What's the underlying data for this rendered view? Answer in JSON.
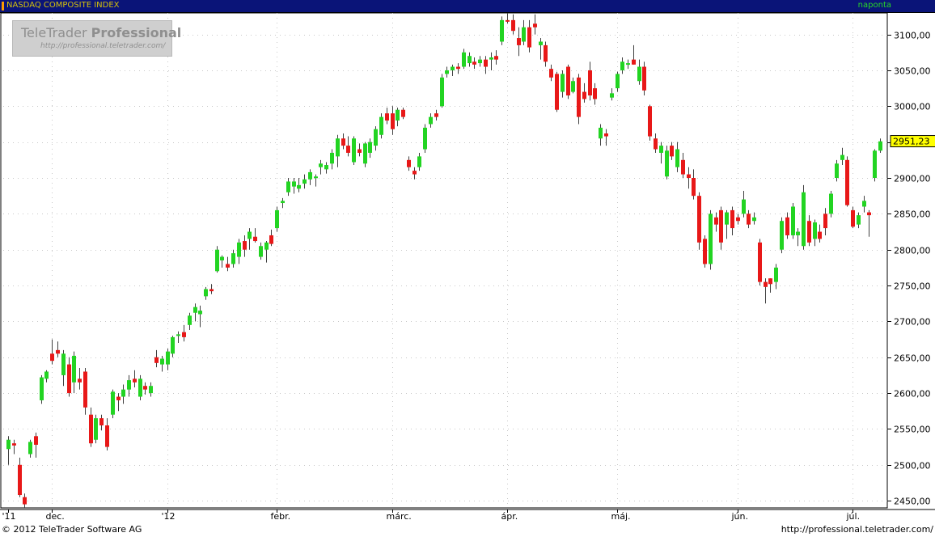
{
  "header": {
    "title": "NASDAQ COMPOSITE INDEX",
    "period": "naponta"
  },
  "watermark": {
    "brand_light": "TeleTrader ",
    "brand_bold": "Professional",
    "site": "http://professional.teletrader.com/"
  },
  "footer": {
    "copyright": "© 2012 TeleTrader Software AG",
    "url": "http://professional.teletrader.com/"
  },
  "colors": {
    "up": "#22d422",
    "down": "#e81818",
    "wick": "#404040",
    "grid": "#c8c8c8",
    "axis_text": "#000000",
    "last_price_bg": "#ffff00"
  },
  "chart_data": {
    "type": "candlestick",
    "y_axis": {
      "min": 2440,
      "max": 3130,
      "ticks": [
        2450,
        2500,
        2550,
        2600,
        2650,
        2700,
        2750,
        2800,
        2850,
        2900,
        2950,
        3000,
        3050,
        3100
      ],
      "tick_labels": [
        "2450,00",
        "2500,00",
        "2550,00",
        "2600,00",
        "2650,00",
        "2700,00",
        "2750,00",
        "2800,00",
        "2850,00",
        "2900,00",
        "2950,00",
        "3000,00",
        "3050,00",
        "3100,00"
      ]
    },
    "last_price": {
      "value": 2951.23,
      "label": "2951,23"
    },
    "x_axis": {
      "labels": [
        {
          "text": "'11",
          "index": 0
        },
        {
          "text": "dec.",
          "index": 8
        },
        {
          "text": "'12",
          "index": 29
        },
        {
          "text": "febr.",
          "index": 49
        },
        {
          "text": "márc.",
          "index": 70
        },
        {
          "text": "ápr.",
          "index": 91
        },
        {
          "text": "máj.",
          "index": 111
        },
        {
          "text": "jún.",
          "index": 133
        },
        {
          "text": "júl.",
          "index": 154
        }
      ]
    },
    "grid": true,
    "candles": [
      {
        "o": 2522,
        "h": 2540,
        "l": 2500,
        "c": 2535
      },
      {
        "o": 2530,
        "h": 2535,
        "l": 2515,
        "c": 2527
      },
      {
        "o": 2500,
        "h": 2510,
        "l": 2455,
        "c": 2458
      },
      {
        "o": 2455,
        "h": 2460,
        "l": 2440,
        "c": 2445
      },
      {
        "o": 2515,
        "h": 2535,
        "l": 2510,
        "c": 2532
      },
      {
        "o": 2540,
        "h": 2545,
        "l": 2510,
        "c": 2528
      },
      {
        "o": 2590,
        "h": 2625,
        "l": 2585,
        "c": 2622
      },
      {
        "o": 2620,
        "h": 2632,
        "l": 2615,
        "c": 2630
      },
      {
        "o": 2655,
        "h": 2675,
        "l": 2640,
        "c": 2645
      },
      {
        "o": 2660,
        "h": 2672,
        "l": 2650,
        "c": 2655
      },
      {
        "o": 2625,
        "h": 2660,
        "l": 2610,
        "c": 2655
      },
      {
        "o": 2640,
        "h": 2650,
        "l": 2595,
        "c": 2600
      },
      {
        "o": 2615,
        "h": 2658,
        "l": 2600,
        "c": 2652
      },
      {
        "o": 2620,
        "h": 2635,
        "l": 2605,
        "c": 2615
      },
      {
        "o": 2630,
        "h": 2635,
        "l": 2570,
        "c": 2580
      },
      {
        "o": 2570,
        "h": 2580,
        "l": 2525,
        "c": 2530
      },
      {
        "o": 2535,
        "h": 2570,
        "l": 2530,
        "c": 2565
      },
      {
        "o": 2565,
        "h": 2570,
        "l": 2548,
        "c": 2555
      },
      {
        "o": 2555,
        "h": 2565,
        "l": 2520,
        "c": 2525
      },
      {
        "o": 2570,
        "h": 2605,
        "l": 2565,
        "c": 2602
      },
      {
        "o": 2595,
        "h": 2600,
        "l": 2575,
        "c": 2590
      },
      {
        "o": 2595,
        "h": 2612,
        "l": 2585,
        "c": 2605
      },
      {
        "o": 2605,
        "h": 2625,
        "l": 2595,
        "c": 2618
      },
      {
        "o": 2620,
        "h": 2632,
        "l": 2608,
        "c": 2615
      },
      {
        "o": 2595,
        "h": 2625,
        "l": 2590,
        "c": 2620
      },
      {
        "o": 2610,
        "h": 2615,
        "l": 2598,
        "c": 2605
      },
      {
        "o": 2600,
        "h": 2615,
        "l": 2595,
        "c": 2610
      },
      {
        "o": 2650,
        "h": 2660,
        "l": 2636,
        "c": 2642
      },
      {
        "o": 2640,
        "h": 2652,
        "l": 2630,
        "c": 2648
      },
      {
        "o": 2640,
        "h": 2662,
        "l": 2632,
        "c": 2658
      },
      {
        "o": 2655,
        "h": 2680,
        "l": 2650,
        "c": 2678
      },
      {
        "o": 2680,
        "h": 2686,
        "l": 2670,
        "c": 2682
      },
      {
        "o": 2685,
        "h": 2695,
        "l": 2672,
        "c": 2678
      },
      {
        "o": 2695,
        "h": 2712,
        "l": 2688,
        "c": 2708
      },
      {
        "o": 2712,
        "h": 2725,
        "l": 2700,
        "c": 2720
      },
      {
        "o": 2710,
        "h": 2722,
        "l": 2692,
        "c": 2715
      },
      {
        "o": 2735,
        "h": 2748,
        "l": 2730,
        "c": 2745
      },
      {
        "o": 2745,
        "h": 2752,
        "l": 2738,
        "c": 2742
      },
      {
        "o": 2770,
        "h": 2805,
        "l": 2768,
        "c": 2800
      },
      {
        "o": 2785,
        "h": 2792,
        "l": 2775,
        "c": 2790
      },
      {
        "o": 2780,
        "h": 2790,
        "l": 2770,
        "c": 2775
      },
      {
        "o": 2780,
        "h": 2800,
        "l": 2775,
        "c": 2795
      },
      {
        "o": 2790,
        "h": 2815,
        "l": 2780,
        "c": 2810
      },
      {
        "o": 2812,
        "h": 2820,
        "l": 2790,
        "c": 2800
      },
      {
        "o": 2815,
        "h": 2830,
        "l": 2800,
        "c": 2825
      },
      {
        "o": 2818,
        "h": 2830,
        "l": 2810,
        "c": 2812
      },
      {
        "o": 2790,
        "h": 2810,
        "l": 2786,
        "c": 2805
      },
      {
        "o": 2800,
        "h": 2812,
        "l": 2782,
        "c": 2810
      },
      {
        "o": 2820,
        "h": 2828,
        "l": 2805,
        "c": 2808
      },
      {
        "o": 2830,
        "h": 2860,
        "l": 2825,
        "c": 2855
      },
      {
        "o": 2865,
        "h": 2872,
        "l": 2858,
        "c": 2868
      },
      {
        "o": 2880,
        "h": 2900,
        "l": 2875,
        "c": 2895
      },
      {
        "o": 2888,
        "h": 2900,
        "l": 2878,
        "c": 2895
      },
      {
        "o": 2885,
        "h": 2900,
        "l": 2880,
        "c": 2890
      },
      {
        "o": 2892,
        "h": 2905,
        "l": 2885,
        "c": 2898
      },
      {
        "o": 2898,
        "h": 2912,
        "l": 2890,
        "c": 2908
      },
      {
        "o": 2900,
        "h": 2905,
        "l": 2888,
        "c": 2902
      },
      {
        "o": 2915,
        "h": 2925,
        "l": 2905,
        "c": 2920
      },
      {
        "o": 2912,
        "h": 2922,
        "l": 2906,
        "c": 2918
      },
      {
        "o": 2920,
        "h": 2940,
        "l": 2912,
        "c": 2935
      },
      {
        "o": 2930,
        "h": 2960,
        "l": 2915,
        "c": 2955
      },
      {
        "o": 2955,
        "h": 2962,
        "l": 2940,
        "c": 2945
      },
      {
        "o": 2945,
        "h": 2958,
        "l": 2930,
        "c": 2935
      },
      {
        "o": 2922,
        "h": 2958,
        "l": 2918,
        "c": 2955
      },
      {
        "o": 2940,
        "h": 2948,
        "l": 2930,
        "c": 2935
      },
      {
        "o": 2920,
        "h": 2950,
        "l": 2915,
        "c": 2948
      },
      {
        "o": 2935,
        "h": 2955,
        "l": 2928,
        "c": 2950
      },
      {
        "o": 2945,
        "h": 2972,
        "l": 2938,
        "c": 2968
      },
      {
        "o": 2960,
        "h": 2990,
        "l": 2955,
        "c": 2985
      },
      {
        "o": 2990,
        "h": 2998,
        "l": 2975,
        "c": 2980
      },
      {
        "o": 2990,
        "h": 3000,
        "l": 2960,
        "c": 2968
      },
      {
        "o": 2980,
        "h": 2998,
        "l": 2972,
        "c": 2995
      },
      {
        "o": 2995,
        "h": 2998,
        "l": 2982,
        "c": 2985
      },
      {
        "o": 2925,
        "h": 2930,
        "l": 2910,
        "c": 2915
      },
      {
        "o": 2910,
        "h": 2915,
        "l": 2898,
        "c": 2905
      },
      {
        "o": 2915,
        "h": 2935,
        "l": 2910,
        "c": 2930
      },
      {
        "o": 2940,
        "h": 2975,
        "l": 2935,
        "c": 2970
      },
      {
        "o": 2975,
        "h": 2990,
        "l": 2970,
        "c": 2985
      },
      {
        "o": 2990,
        "h": 2995,
        "l": 2980,
        "c": 2985
      },
      {
        "o": 3000,
        "h": 3045,
        "l": 2998,
        "c": 3040
      },
      {
        "o": 3045,
        "h": 3055,
        "l": 3040,
        "c": 3050
      },
      {
        "o": 3050,
        "h": 3058,
        "l": 3042,
        "c": 3055
      },
      {
        "o": 3055,
        "h": 3060,
        "l": 3045,
        "c": 3052
      },
      {
        "o": 3055,
        "h": 3080,
        "l": 3052,
        "c": 3075
      },
      {
        "o": 3060,
        "h": 3075,
        "l": 3055,
        "c": 3070
      },
      {
        "o": 3062,
        "h": 3068,
        "l": 3052,
        "c": 3058
      },
      {
        "o": 3060,
        "h": 3070,
        "l": 3055,
        "c": 3065
      },
      {
        "o": 3065,
        "h": 3070,
        "l": 3045,
        "c": 3055
      },
      {
        "o": 3065,
        "h": 3075,
        "l": 3050,
        "c": 3068
      },
      {
        "o": 3070,
        "h": 3078,
        "l": 3058,
        "c": 3065
      },
      {
        "o": 3090,
        "h": 3125,
        "l": 3085,
        "c": 3120
      },
      {
        "o": 3120,
        "h": 3130,
        "l": 3115,
        "c": 3118
      },
      {
        "o": 3120,
        "h": 3128,
        "l": 3100,
        "c": 3105
      },
      {
        "o": 3095,
        "h": 3110,
        "l": 3070,
        "c": 3085
      },
      {
        "o": 3090,
        "h": 3120,
        "l": 3085,
        "c": 3110
      },
      {
        "o": 3110,
        "h": 3120,
        "l": 3075,
        "c": 3082
      },
      {
        "o": 3115,
        "h": 3128,
        "l": 3100,
        "c": 3110
      },
      {
        "o": 3085,
        "h": 3095,
        "l": 3065,
        "c": 3090
      },
      {
        "o": 3085,
        "h": 3090,
        "l": 3055,
        "c": 3062
      },
      {
        "o": 3052,
        "h": 3058,
        "l": 3035,
        "c": 3040
      },
      {
        "o": 3045,
        "h": 3048,
        "l": 2992,
        "c": 2995
      },
      {
        "o": 3020,
        "h": 3050,
        "l": 3012,
        "c": 3045
      },
      {
        "o": 3055,
        "h": 3058,
        "l": 3010,
        "c": 3015
      },
      {
        "o": 3020,
        "h": 3040,
        "l": 3018,
        "c": 3035
      },
      {
        "o": 3040,
        "h": 3045,
        "l": 2975,
        "c": 2985
      },
      {
        "o": 3020,
        "h": 3032,
        "l": 3005,
        "c": 3010
      },
      {
        "o": 3050,
        "h": 3062,
        "l": 3008,
        "c": 3015
      },
      {
        "o": 3025,
        "h": 3032,
        "l": 3002,
        "c": 3010
      },
      {
        "o": 2955,
        "h": 2975,
        "l": 2945,
        "c": 2970
      },
      {
        "o": 2962,
        "h": 2968,
        "l": 2945,
        "c": 2958
      },
      {
        "o": 3012,
        "h": 3025,
        "l": 3008,
        "c": 3018
      },
      {
        "o": 3025,
        "h": 3048,
        "l": 3020,
        "c": 3045
      },
      {
        "o": 3050,
        "h": 3068,
        "l": 3045,
        "c": 3062
      },
      {
        "o": 3058,
        "h": 3065,
        "l": 3052,
        "c": 3060
      },
      {
        "o": 3065,
        "h": 3085,
        "l": 3058,
        "c": 3058
      },
      {
        "o": 3035,
        "h": 3065,
        "l": 3030,
        "c": 3055
      },
      {
        "o": 3055,
        "h": 3062,
        "l": 3015,
        "c": 3022
      },
      {
        "o": 3000,
        "h": 3002,
        "l": 2952,
        "c": 2958
      },
      {
        "o": 2955,
        "h": 2962,
        "l": 2935,
        "c": 2940
      },
      {
        "o": 2935,
        "h": 2950,
        "l": 2920,
        "c": 2945
      },
      {
        "o": 2902,
        "h": 2945,
        "l": 2898,
        "c": 2938
      },
      {
        "o": 2945,
        "h": 2950,
        "l": 2925,
        "c": 2930
      },
      {
        "o": 2915,
        "h": 2950,
        "l": 2908,
        "c": 2940
      },
      {
        "o": 2925,
        "h": 2935,
        "l": 2900,
        "c": 2905
      },
      {
        "o": 2905,
        "h": 2915,
        "l": 2885,
        "c": 2900
      },
      {
        "o": 2900,
        "h": 2912,
        "l": 2870,
        "c": 2875
      },
      {
        "o": 2875,
        "h": 2880,
        "l": 2800,
        "c": 2810
      },
      {
        "o": 2815,
        "h": 2820,
        "l": 2775,
        "c": 2780
      },
      {
        "o": 2780,
        "h": 2855,
        "l": 2772,
        "c": 2850
      },
      {
        "o": 2845,
        "h": 2852,
        "l": 2825,
        "c": 2835
      },
      {
        "o": 2855,
        "h": 2860,
        "l": 2800,
        "c": 2810
      },
      {
        "o": 2835,
        "h": 2855,
        "l": 2815,
        "c": 2852
      },
      {
        "o": 2855,
        "h": 2860,
        "l": 2820,
        "c": 2830
      },
      {
        "o": 2845,
        "h": 2850,
        "l": 2835,
        "c": 2840
      },
      {
        "o": 2850,
        "h": 2882,
        "l": 2845,
        "c": 2870
      },
      {
        "o": 2850,
        "h": 2855,
        "l": 2830,
        "c": 2835
      },
      {
        "o": 2840,
        "h": 2852,
        "l": 2835,
        "c": 2845
      },
      {
        "o": 2810,
        "h": 2815,
        "l": 2750,
        "c": 2755
      },
      {
        "o": 2755,
        "h": 2760,
        "l": 2725,
        "c": 2748
      },
      {
        "o": 2760,
        "h": 2760,
        "l": 2740,
        "c": 2752
      },
      {
        "o": 2755,
        "h": 2780,
        "l": 2745,
        "c": 2775
      },
      {
        "o": 2800,
        "h": 2845,
        "l": 2795,
        "c": 2840
      },
      {
        "o": 2845,
        "h": 2852,
        "l": 2815,
        "c": 2820
      },
      {
        "o": 2820,
        "h": 2865,
        "l": 2815,
        "c": 2860
      },
      {
        "o": 2820,
        "h": 2830,
        "l": 2805,
        "c": 2825
      },
      {
        "o": 2805,
        "h": 2890,
        "l": 2800,
        "c": 2880
      },
      {
        "o": 2840,
        "h": 2848,
        "l": 2805,
        "c": 2810
      },
      {
        "o": 2815,
        "h": 2842,
        "l": 2805,
        "c": 2838
      },
      {
        "o": 2825,
        "h": 2835,
        "l": 2810,
        "c": 2815
      },
      {
        "o": 2850,
        "h": 2858,
        "l": 2820,
        "c": 2830
      },
      {
        "o": 2850,
        "h": 2882,
        "l": 2845,
        "c": 2878
      },
      {
        "o": 2900,
        "h": 2925,
        "l": 2895,
        "c": 2920
      },
      {
        "o": 2925,
        "h": 2942,
        "l": 2918,
        "c": 2932
      },
      {
        "o": 2925,
        "h": 2930,
        "l": 2860,
        "c": 2862
      },
      {
        "o": 2855,
        "h": 2860,
        "l": 2830,
        "c": 2832
      },
      {
        "o": 2835,
        "h": 2852,
        "l": 2830,
        "c": 2848
      },
      {
        "o": 2860,
        "h": 2875,
        "l": 2852,
        "c": 2868
      },
      {
        "o": 2852,
        "h": 2855,
        "l": 2818,
        "c": 2848
      },
      {
        "o": 2900,
        "h": 2940,
        "l": 2895,
        "c": 2938
      },
      {
        "o": 2938,
        "h": 2955,
        "l": 2935,
        "c": 2951
      }
    ]
  }
}
